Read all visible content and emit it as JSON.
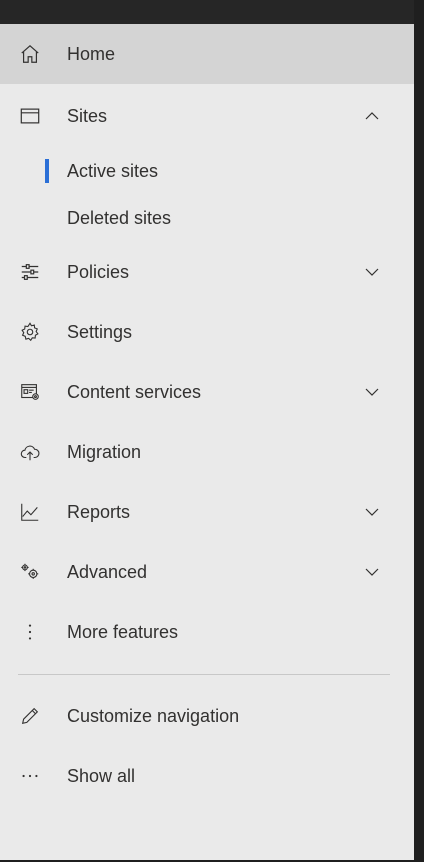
{
  "nav": {
    "home": {
      "label": "Home",
      "icon": "home-icon"
    },
    "sites": {
      "label": "Sites",
      "icon": "browser-window-icon",
      "expanded": true
    },
    "sites_sub": {
      "active": {
        "label": "Active sites",
        "selected": true
      },
      "deleted": {
        "label": "Deleted sites"
      }
    },
    "policies": {
      "label": "Policies",
      "icon": "sliders-icon"
    },
    "settings": {
      "label": "Settings",
      "icon": "gear-icon"
    },
    "content_services": {
      "label": "Content services",
      "icon": "content-services-icon"
    },
    "migration": {
      "label": "Migration",
      "icon": "cloud-upload-icon"
    },
    "reports": {
      "label": "Reports",
      "icon": "line-chart-icon"
    },
    "advanced": {
      "label": "Advanced",
      "icon": "gears-icon"
    },
    "more_features": {
      "label": "More features",
      "icon": "vertical-ellipsis-icon"
    },
    "customize": {
      "label": "Customize navigation",
      "icon": "pencil-icon"
    },
    "show_all": {
      "label": "Show all",
      "icon": "horizontal-ellipsis-icon"
    }
  },
  "colors": {
    "nav_bg": "#eaeaea",
    "selected_bg": "#d4d4d4",
    "active_indicator": "#2b6fd6",
    "text": "#323130"
  }
}
